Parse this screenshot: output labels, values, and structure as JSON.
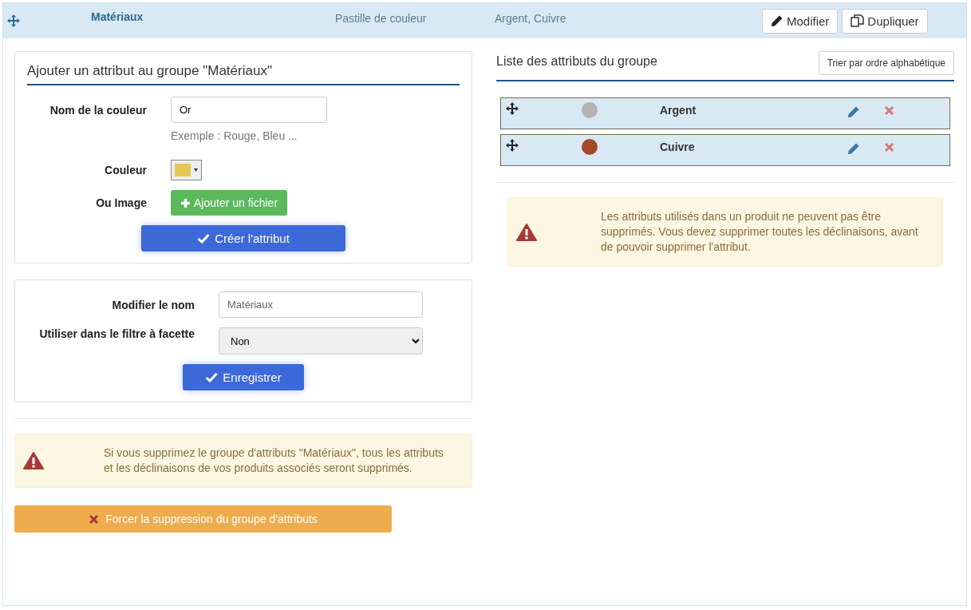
{
  "header": {
    "name": "Matériaux",
    "type": "Pastille de couleur",
    "values": "Argent, Cuivre",
    "buttons": [
      {
        "label": "Modifier",
        "kind": "edit"
      },
      {
        "label": "Dupliquer",
        "kind": "copy"
      }
    ]
  },
  "add_form": {
    "title": "Ajouter un attribut au groupe \"Matériaux\"",
    "name_label": "Nom de la couleur",
    "name_value": "Or",
    "name_help": "Exemple : Rouge, Bleu ...",
    "color_label": "Couleur",
    "color": "#e5c656",
    "image_label": "Ou Image",
    "image_button": "Ajouter un fichier",
    "submit": "Créer l'attribut"
  },
  "edit_form": {
    "name_label": "Modifier le nom",
    "name_value": "Matériaux",
    "filter_label": "Utiliser dans le filtre à facette",
    "filter_value": "Non",
    "submit": "Enregistrer"
  },
  "group_warning": "Si vous supprimez le groupe d'attributs \"Matériaux\", tous les attributs et les déclinaisons de vos produits associés seront supprimés.",
  "force_delete": "Forcer la suppression du groupe d'attributs",
  "attribute_list": {
    "title": "Liste des attributs du groupe",
    "sort_button": "Trier par ordre alphabétique",
    "items": [
      {
        "name": "Argent",
        "color": "#b3b3b3"
      },
      {
        "name": "Cuivre",
        "color": "#a4482b"
      }
    ],
    "warning": "Les attributs utilisés dans un produit ne peuvent pas être supprimés. Vous devez supprimer toutes les déclinaisons, avant de pouvoir supprimer l'attribut."
  }
}
